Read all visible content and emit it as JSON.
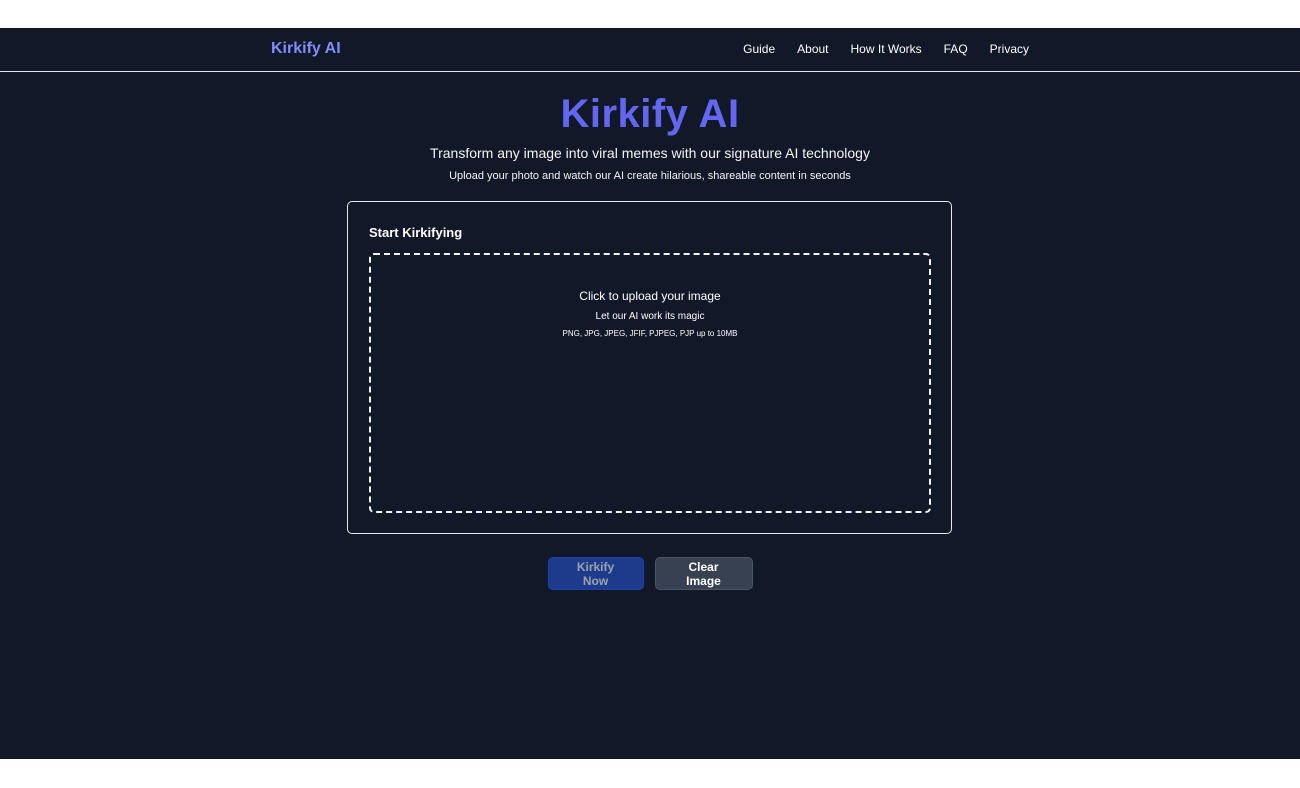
{
  "nav": {
    "brand": "Kirkify AI",
    "links": [
      "Guide",
      "About",
      "How It Works",
      "FAQ",
      "Privacy"
    ]
  },
  "hero": {
    "title": "Kirkify AI",
    "subtitle": "Transform any image into viral memes with our signature AI technology",
    "tagline": "Upload your photo and watch our AI create hilarious, shareable content in seconds"
  },
  "upload_card": {
    "title": "Start Kirkifying",
    "dropzone": {
      "main_text": "Click to upload your image",
      "sub_text": "Let our AI work its magic",
      "formats": "PNG, JPG, JPEG, JFIF, PJPEG, PJP up to 10MB"
    }
  },
  "actions": {
    "primary_label": "Kirkify Now",
    "primary_disabled": true,
    "secondary_label": "Clear Image"
  },
  "colors": {
    "background": "#111827",
    "accent": "#6366f1",
    "brand": "#818cf8",
    "primary_button": "#1e3a8a",
    "secondary_button": "#374151"
  }
}
